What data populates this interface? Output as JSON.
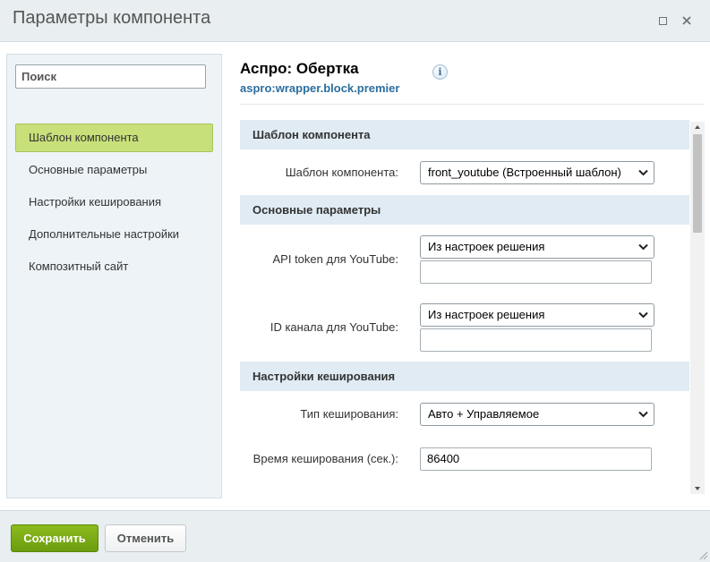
{
  "window": {
    "title": "Параметры компонента"
  },
  "sidebar": {
    "search_placeholder": "Поиск",
    "items": [
      {
        "label": "Шаблон компонента",
        "active": true
      },
      {
        "label": "Основные параметры"
      },
      {
        "label": "Настройки кеширования"
      },
      {
        "label": "Дополнительные настройки"
      },
      {
        "label": "Композитный сайт"
      }
    ]
  },
  "component": {
    "title": "Аспро: Обертка",
    "code": "aspro:wrapper.block.premier",
    "info_icon": "i"
  },
  "sections": {
    "template": {
      "header": "Шаблон компонента",
      "template_label": "Шаблон компонента:",
      "template_value": "front_youtube (Встроенный шаблон)"
    },
    "main": {
      "header": "Основные параметры",
      "api_label": "API token для YouTube:",
      "api_select": "Из настроек решения",
      "api_input": "",
      "channel_label": "ID канала для YouTube:",
      "channel_select": "Из настроек решения",
      "channel_input": ""
    },
    "cache": {
      "header": "Настройки кеширования",
      "type_label": "Тип кеширования:",
      "type_value": "Авто + Управляемое",
      "time_label": "Время кеширования (сек.):",
      "time_value": "86400"
    }
  },
  "footer": {
    "save_label": "Сохранить",
    "cancel_label": "Отменить"
  },
  "colors": {
    "save_button": "#7aab15",
    "active_nav": "#c8e07a",
    "section_header": "#e0ebf3",
    "component_code": "#2c6e9e"
  }
}
